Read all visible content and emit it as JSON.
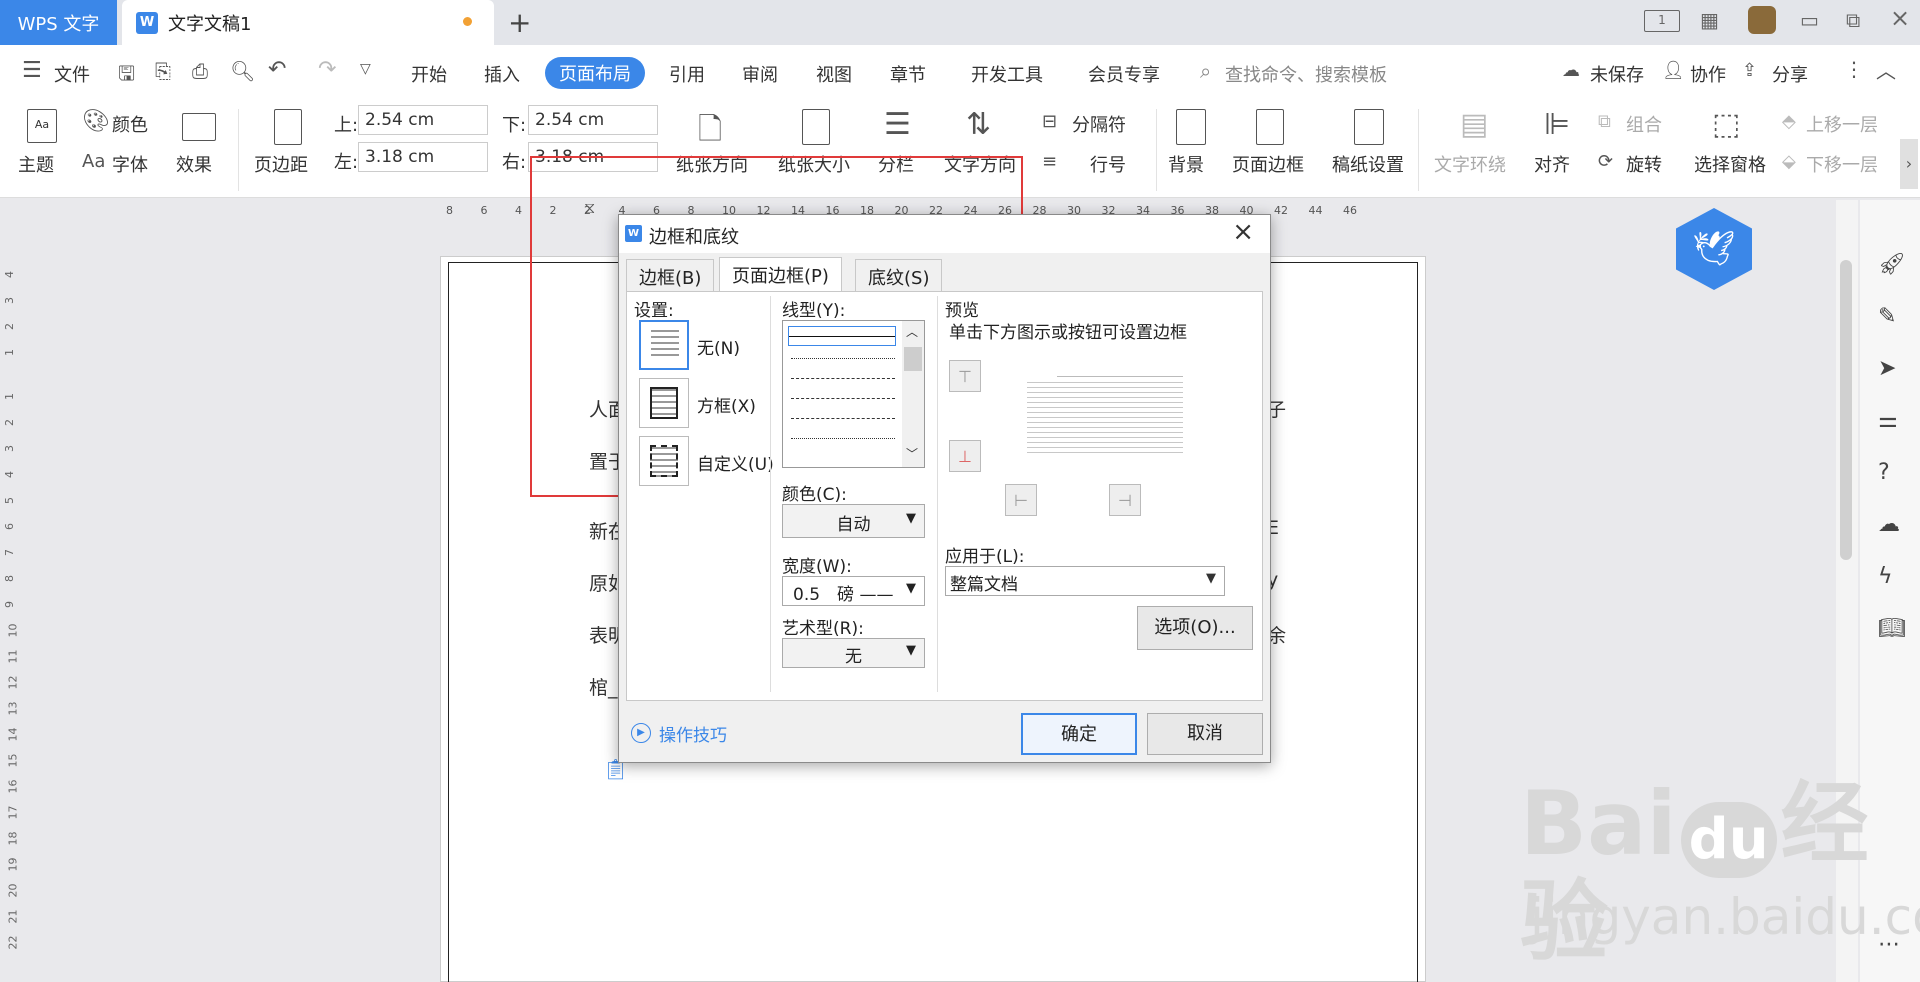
{
  "titlebar": {
    "app_tab": "WPS 文字",
    "doc_tab": "文字文稿1",
    "new_tab": "+"
  },
  "menubar": {
    "file": "文件",
    "tabs": [
      "开始",
      "插入",
      "页面布局",
      "引用",
      "审阅",
      "视图",
      "章节",
      "开发工具",
      "会员专享"
    ],
    "active_tab": "页面布局",
    "search_placeholder": "查找命令、搜索模板",
    "unsaved": "未保存",
    "collab": "协作",
    "share": "分享"
  },
  "ribbon": {
    "theme": "主题",
    "colors": "颜色",
    "fonts": "字体",
    "effects": "效果",
    "margins": "页边距",
    "top_label": "上:",
    "top_value": "2.54 cm",
    "bottom_label": "下:",
    "bottom_value": "2.54 cm",
    "left_label": "左:",
    "left_value": "3.18 cm",
    "right_label": "右:",
    "right_value": "3.18 cm",
    "orientation": "纸张方向",
    "size": "纸张大小",
    "columns": "分栏",
    "text_direction": "文字方向",
    "breaks": "分隔符",
    "line_numbers": "行号",
    "background": "背景",
    "page_border": "页面边框",
    "paper_setup": "稿纸设置",
    "text_wrap": "文字环绕",
    "align": "对齐",
    "group": "组合",
    "rotate": "旋转",
    "selection_pane": "选择窗格",
    "bring_forward": "上移一层",
    "send_backward": "下移一层"
  },
  "ruler": {
    "ticks": [
      "8",
      "6",
      "4",
      "2",
      "2",
      "4",
      "6",
      "8",
      "10",
      "12",
      "14",
      "16",
      "18",
      "20",
      "22",
      "24",
      "26",
      "28",
      "30",
      "32",
      "34",
      "36",
      "38",
      "40",
      "42",
      "44",
      "46"
    ],
    "v_ticks": [
      "4",
      "3",
      "2",
      "1",
      "1",
      "2",
      "3",
      "4",
      "5",
      "6",
      "7",
      "8",
      "9",
      "10",
      "11",
      "12",
      "13",
      "14",
      "15",
      "16",
      "17",
      "18",
      "19",
      "20",
      "21",
      "22"
    ]
  },
  "document": {
    "lines": [
      "人面",
      "置于",
      "新在",
      "原如",
      "表明",
      "棺_"
    ],
    "right_chars": [
      "子",
      "",
      "E",
      "y",
      "余"
    ]
  },
  "dialog": {
    "title": "边框和底纹",
    "tabs": [
      "边框(B)",
      "页面边框(P)",
      "底纹(S)"
    ],
    "active_tab": "页面边框(P)",
    "settings_label": "设置:",
    "settings": [
      "无(N)",
      "方框(X)",
      "自定义(U)"
    ],
    "line_style_label": "线型(Y):",
    "color_label": "颜色(C):",
    "color_value": "自动",
    "width_label": "宽度(W):",
    "width_value": "0.5　磅 ——",
    "art_label": "艺术型(R):",
    "art_value": "无",
    "preview_label": "预览",
    "preview_hint": "单击下方图示或按钮可设置边框",
    "apply_label": "应用于(L):",
    "apply_value": "整篇文档",
    "options_button": "选项(O)...",
    "tips": "操作技巧",
    "ok": "确定",
    "cancel": "取消"
  },
  "watermark": {
    "brand": "Bai",
    "brand2": "du",
    "cn": "经验",
    "url": "jingyan.baidu.com"
  },
  "colors": {
    "accent": "#3b87e8",
    "highlight": "#e03a3a",
    "unsaved_dot": "#f2a134"
  }
}
